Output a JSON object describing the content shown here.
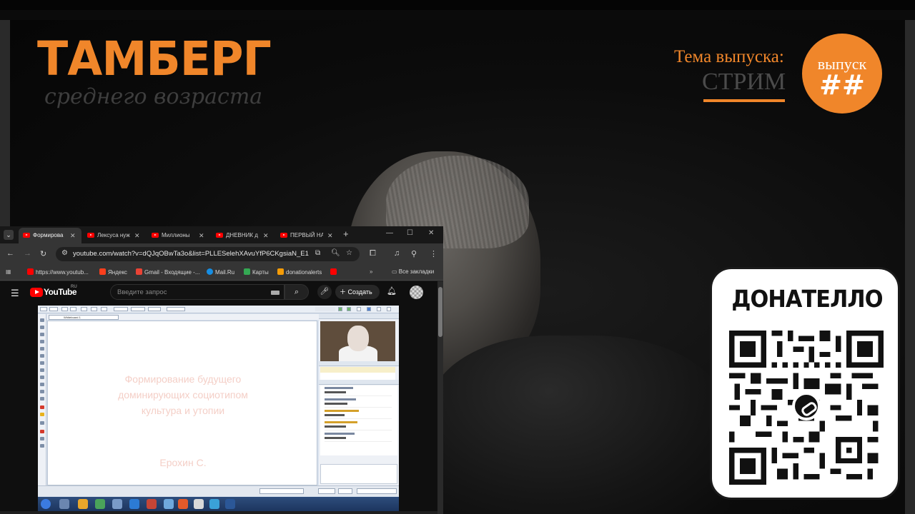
{
  "overlay": {
    "brand_title": "ТАМБЕРГ",
    "brand_subtitle": "среднего возраста",
    "topic_label": "Тема выпуска:",
    "topic_value": "СТРИМ",
    "episode_label": "выпуск",
    "episode_number": "##",
    "accent_color": "#f0862a"
  },
  "donation": {
    "title": "ДОНАТЕЛЛО",
    "qr_icon": "qr-code-icon"
  },
  "browser": {
    "tabs": [
      {
        "label": "Формирова",
        "active": true
      },
      {
        "label": "Лексуса нуж",
        "active": false
      },
      {
        "label": "Миллионы",
        "active": false
      },
      {
        "label": "ДНЕВНИК д",
        "active": false
      },
      {
        "label": "ПЕРВЫЙ НА",
        "active": false
      }
    ],
    "url": "youtube.com/watch?v=dQJqOBwTa3o&list=PLLESelehXAvuYfP6CKgsiaN_E1CYpu...",
    "bookmarks": [
      {
        "label": "https://www.youtub...",
        "color": "#ff0000"
      },
      {
        "label": "Яндекс",
        "color": "#fc3f1d"
      },
      {
        "label": "Gmail - Входящие -...",
        "color": "#ea4335"
      },
      {
        "label": "Mail.Ru",
        "color": "#168de2"
      },
      {
        "label": "Карты",
        "color": "#34a853"
      },
      {
        "label": "donationalerts",
        "color": "#f59c07"
      }
    ],
    "all_bookmarks": "Все закладки"
  },
  "youtube": {
    "logo_text": "YouTube",
    "region": "RU",
    "search_placeholder": "Введите запрос",
    "create_label": "Создать"
  },
  "recording": {
    "whiteboard_tab": "Whiteboard 1",
    "slide_title_lines": [
      "Формирование будущего",
      "доминирующих социотипом",
      "культура и утопии"
    ],
    "slide_author": "Ерохин С."
  }
}
